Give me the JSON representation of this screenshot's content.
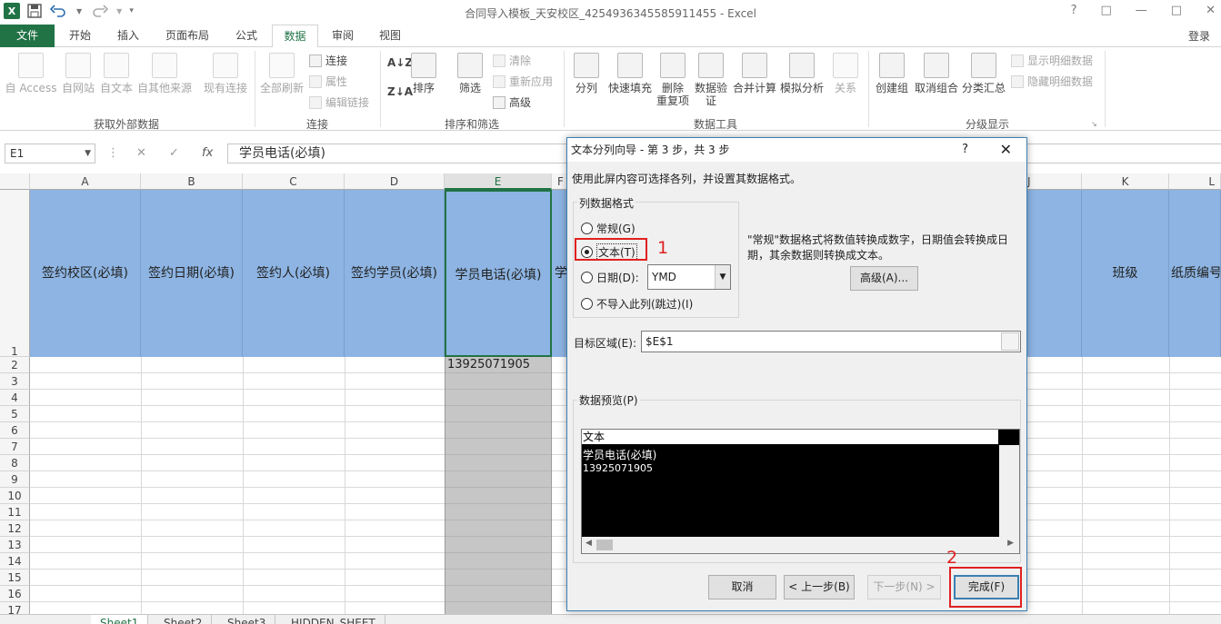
{
  "window": {
    "title": "合同导入模板_天安校区_4254936345585911455 - Excel",
    "app_icon": "X",
    "controls": [
      "?",
      "□",
      "—",
      "□",
      "✕"
    ]
  },
  "ribbon_tabs": [
    {
      "label": "文件",
      "type": "file"
    },
    {
      "label": "开始"
    },
    {
      "label": "插入"
    },
    {
      "label": "页面布局"
    },
    {
      "label": "公式"
    },
    {
      "label": "数据",
      "active": true
    },
    {
      "label": "审阅"
    },
    {
      "label": "视图"
    }
  ],
  "login_label": "登录",
  "ribbon": {
    "get_external": {
      "group_label": "获取外部数据",
      "buttons": [
        "自 Access",
        "自网站",
        "自文本",
        "自其他来源",
        "现有连接"
      ]
    },
    "connections": {
      "group_label": "连接",
      "refresh_all": "全部刷新",
      "items": [
        "连接",
        "属性",
        "编辑链接"
      ]
    },
    "sort_filter": {
      "group_label": "排序和筛选",
      "sort": "排序",
      "filter": "筛选",
      "items": [
        "清除",
        "重新应用",
        "高级"
      ]
    },
    "data_tools": {
      "group_label": "数据工具",
      "buttons": [
        "分列",
        "快速填充",
        "删除\n重复项",
        "数据验\n证",
        "合并计算",
        "模拟分析",
        "关系"
      ]
    },
    "outline": {
      "group_label": "分级显示",
      "buttons": [
        "创建组",
        "取消组合",
        "分类汇总"
      ],
      "items": [
        "显示明细数据",
        "隐藏明细数据"
      ]
    }
  },
  "formula_bar": {
    "name_box": "E1",
    "cancel_glyph": "✕",
    "enter_glyph": "✓",
    "fx_label": "fx",
    "content": "学员电话(必填)"
  },
  "grid": {
    "columns": [
      "A",
      "B",
      "C",
      "D",
      "E",
      "F",
      "J",
      "K",
      "L"
    ],
    "header_cells": [
      "签约校区(必填)",
      "签约日期(必填)",
      "签约人(必填)",
      "签约学员(必填)",
      "学员电话(必填)",
      "学",
      "班级",
      "纸质编号"
    ],
    "rows": [
      "1",
      "2",
      "3",
      "4",
      "5",
      "6",
      "7",
      "8",
      "9",
      "10",
      "11",
      "12",
      "13",
      "14",
      "15",
      "16",
      "17"
    ],
    "e2_value": "13925071905"
  },
  "sheet_tabs": [
    "Sheet1",
    "Sheet2",
    "Sheet3",
    "HIDDEN_SHEET"
  ],
  "dialog": {
    "title": "文本分列向导 - 第 3 步，共 3 步",
    "help": "?",
    "close": "✕",
    "intro": "使用此屏内容可选择各列，并设置其数据格式。",
    "format_group_label": "列数据格式",
    "options": [
      {
        "label": "常规(G)",
        "checked": false
      },
      {
        "label": "文本(T)",
        "checked": true
      },
      {
        "label": "日期(D):",
        "checked": false
      },
      {
        "label": "不导入此列(跳过)(I)",
        "checked": false
      }
    ],
    "date_format": "YMD",
    "description_line1": "\"常规\"数据格式将数值转换成数字，日期值会转换成日",
    "description_line2": "期，其余数据则转换成文本。",
    "advanced_button": "高级(A)...",
    "destination_label": "目标区域(E):",
    "destination_value": "$E$1",
    "preview_label": "数据预览(P)",
    "preview_header": "文本",
    "preview_rows": [
      "学员电话(必填)",
      "13925071905"
    ],
    "buttons": {
      "cancel": "取消",
      "back": "< 上一步(B)",
      "next": "下一步(N) >",
      "finish": "完成(F)"
    }
  },
  "annotations": [
    "1",
    "2"
  ]
}
